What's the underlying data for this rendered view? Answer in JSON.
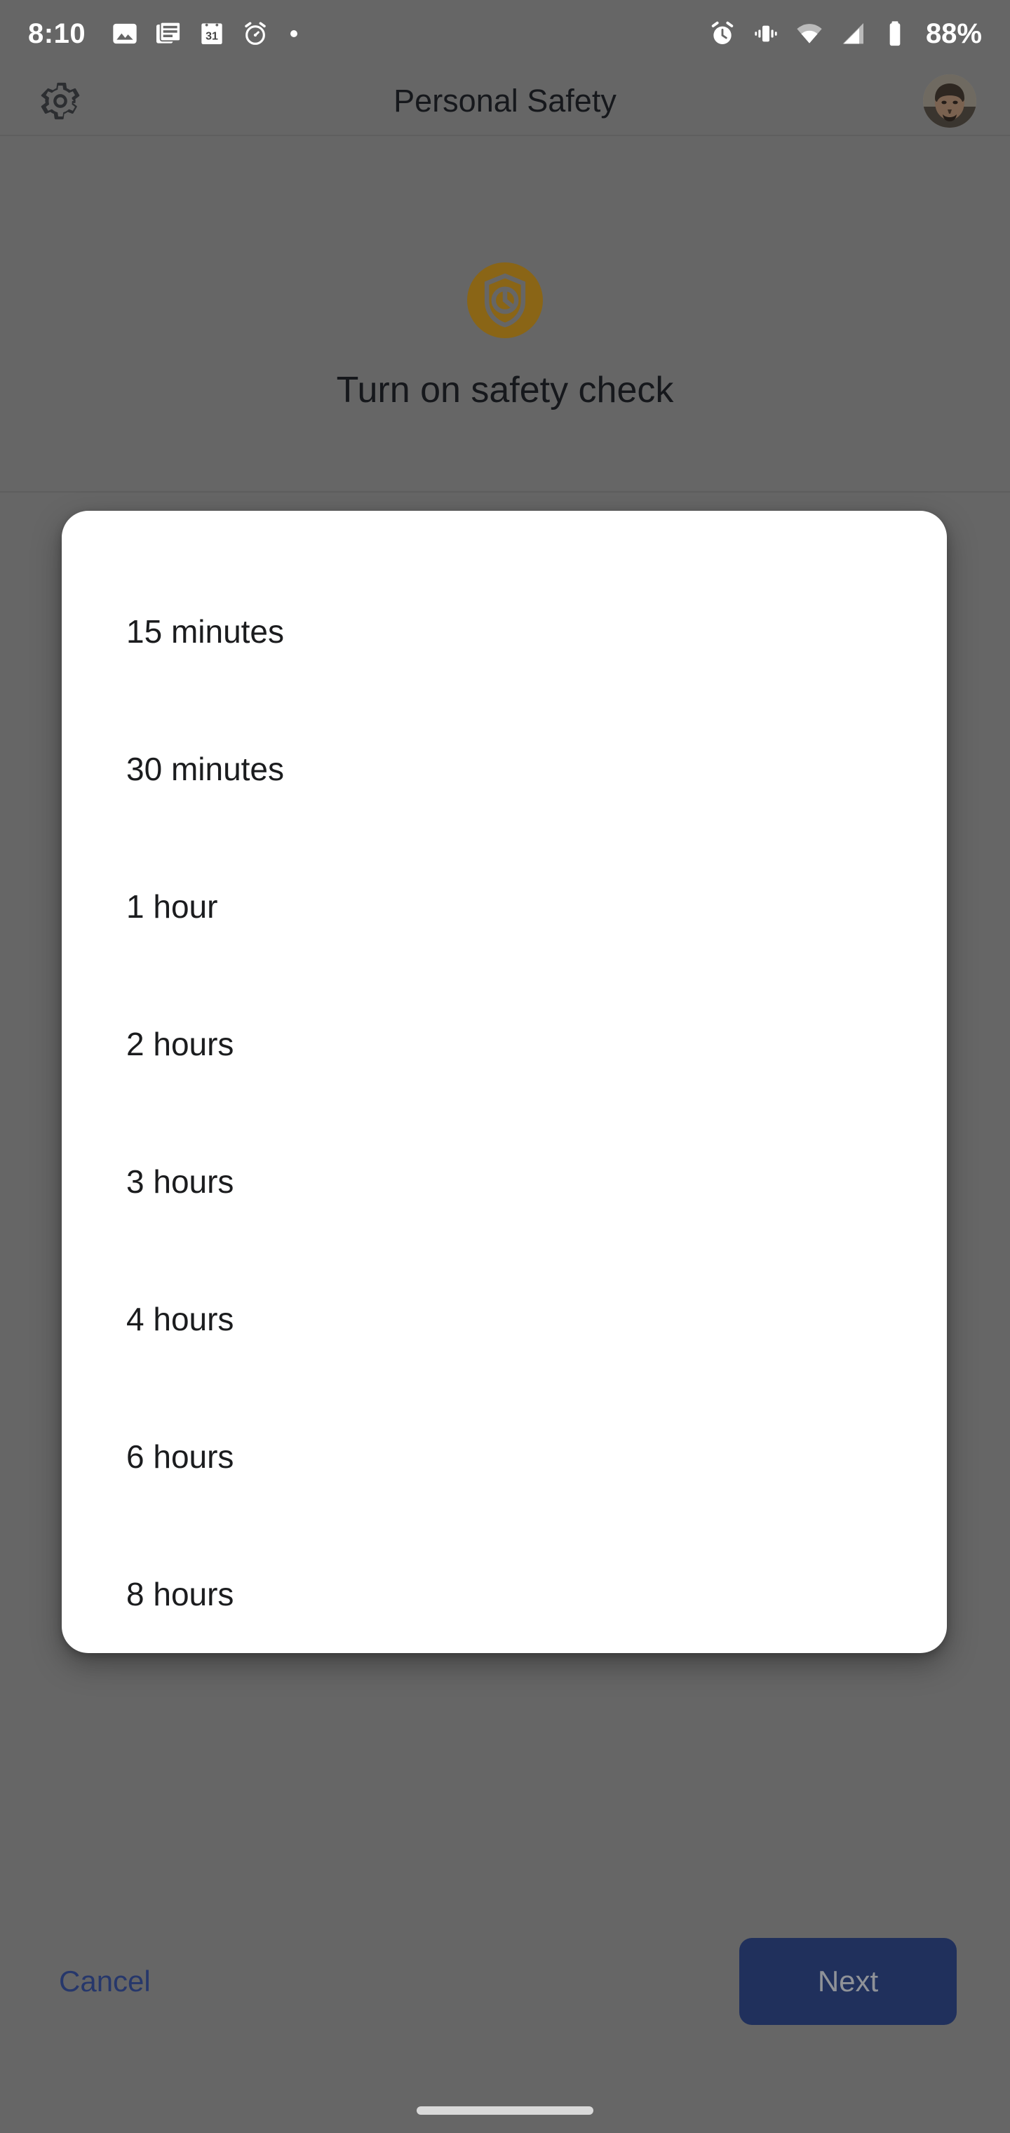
{
  "status_bar": {
    "clock": "8:10",
    "battery_percent": "88%",
    "left_icons": [
      "photo-icon",
      "news-article-icon",
      "calendar-31-icon",
      "alarm-clock-icon",
      "dot-indicator-icon"
    ],
    "calendar_day": "31",
    "right_icons": [
      "alarm-clock-icon",
      "vibrate-icon",
      "wifi-icon",
      "cell-signal-icon",
      "battery-icon"
    ]
  },
  "app_bar": {
    "settings_icon": "gear-icon",
    "title": "Personal Safety",
    "avatar": "user-avatar"
  },
  "hero": {
    "icon": "shield-clock-icon",
    "icon_color": "#8a6516",
    "title": "Turn on safety check"
  },
  "dialog": {
    "name": "safety-check-duration-dialog",
    "options": [
      {
        "label": "15 minutes"
      },
      {
        "label": "30 minutes"
      },
      {
        "label": "1 hour"
      },
      {
        "label": "2 hours"
      },
      {
        "label": "3 hours"
      },
      {
        "label": "4 hours"
      },
      {
        "label": "6 hours"
      },
      {
        "label": "8 hours"
      }
    ]
  },
  "bottom_bar": {
    "cancel_label": "Cancel",
    "cancel_color": "#26376b",
    "next_label": "Next",
    "next_bg": "#20305c",
    "next_text_color": "#8f9298"
  },
  "system_nav": {
    "gesture_bar": "home-gesture-bar"
  },
  "colors": {
    "scrim": "#666666",
    "dialog_bg": "#ffffff",
    "accent_amber": "#8a6516"
  }
}
